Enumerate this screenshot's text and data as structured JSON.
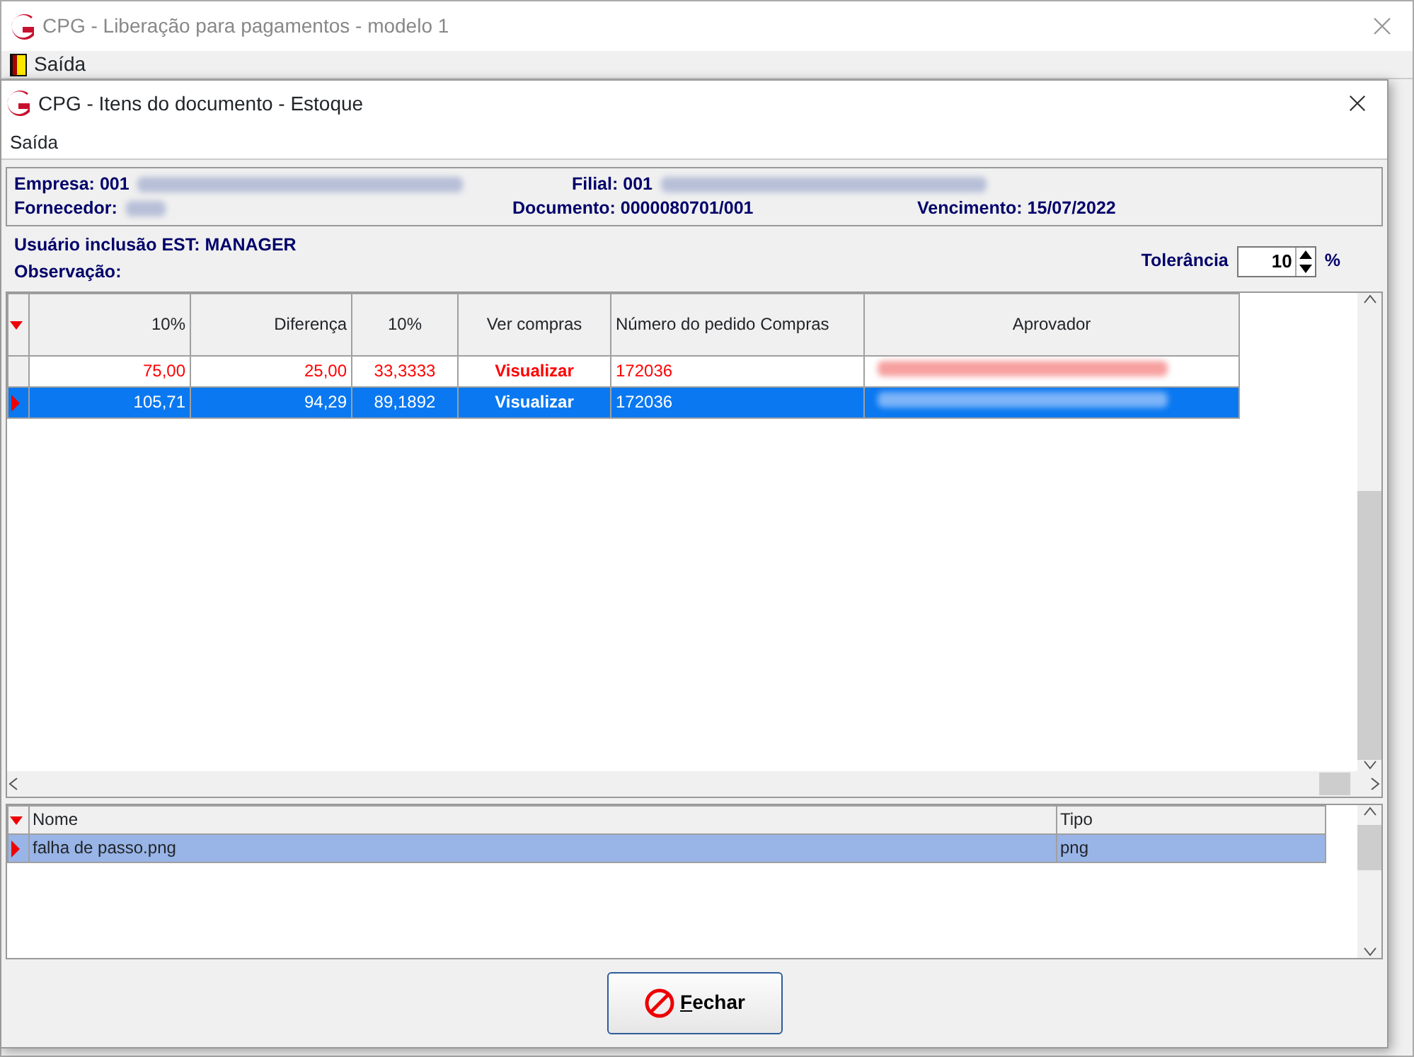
{
  "parent_window": {
    "title": "CPG - Liberação para pagamentos - modelo 1",
    "menu": [
      "Saída"
    ]
  },
  "window": {
    "title": "CPG - Itens do documento - Estoque",
    "menu": [
      "Saída"
    ]
  },
  "header_rows": [
    [
      {
        "text": "Empresa: 001",
        "redacted": true
      },
      {
        "text": "Filial: 001",
        "redacted": true
      }
    ],
    [
      {
        "text": "Fornecedor:",
        "redacted": true
      },
      {
        "text": "Documento: 0000080701/001",
        "redacted": false
      },
      {
        "text": "Vencimento: 15/07/2022",
        "redacted": false
      }
    ]
  ],
  "user_line": "Usuário inclusão EST: MANAGER",
  "observation_label": "Observação:",
  "tolerance": {
    "label": "Tolerância",
    "value": "10",
    "unit": "%"
  },
  "items_grid": {
    "columns": [
      "10%",
      "Diferença",
      "10%",
      "Ver compras",
      "Número do pedido Compras",
      "Aprovador"
    ],
    "rows": [
      {
        "cells": [
          "75,00",
          "25,00",
          "33,3333",
          "Visualizar",
          "172036"
        ],
        "approver_redacted": true,
        "alert": true,
        "selected": false
      },
      {
        "cells": [
          "105,71",
          "94,29",
          "89,1892",
          "Visualizar",
          "172036"
        ],
        "approver_redacted": true,
        "alert": false,
        "selected": true
      }
    ]
  },
  "files_grid": {
    "columns": [
      "Nome",
      "Tipo"
    ],
    "rows": [
      {
        "cells": [
          "falha de passo.png",
          "png"
        ],
        "selected": true
      }
    ]
  },
  "buttons": [
    {
      "label": "Fechar"
    }
  ]
}
